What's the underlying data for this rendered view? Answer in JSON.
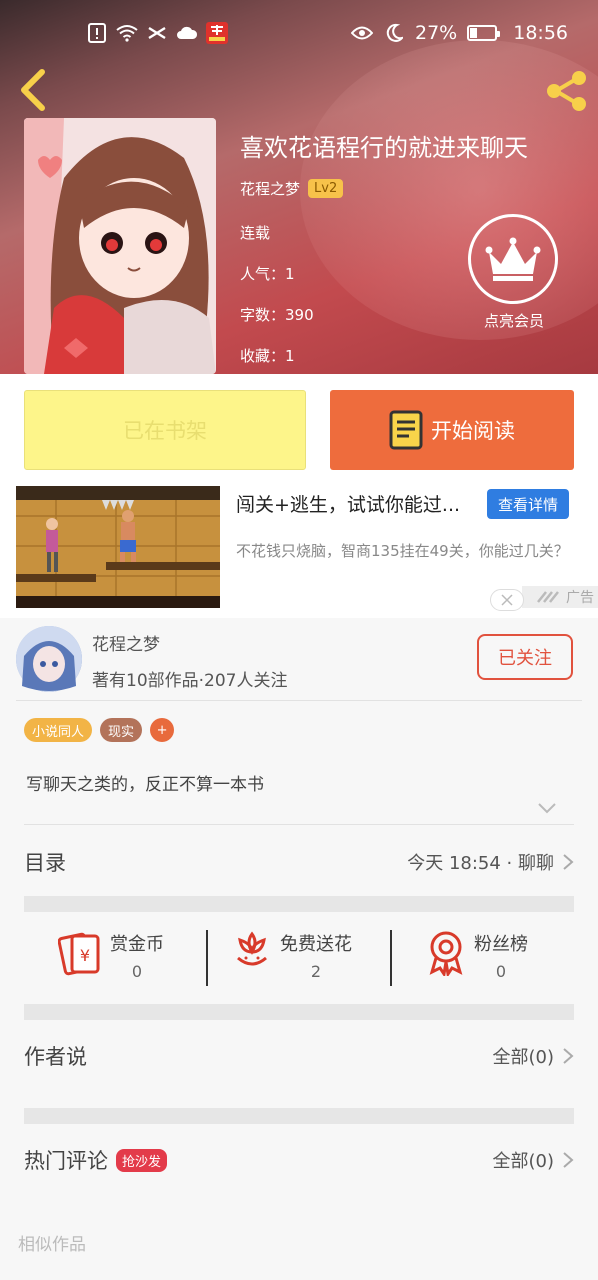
{
  "status_bar": {
    "battery": "27%",
    "time": "18:56"
  },
  "book": {
    "title": "喜欢花语程行的就进来聊天",
    "author": "花程之梦",
    "level": "Lv2",
    "state": "连载",
    "popularity": "人气：1",
    "words": "字数：390",
    "favorites": "收藏：1",
    "vip_label": "点亮会员"
  },
  "actions": {
    "shelf_label": "已在书架",
    "read_label": "开始阅读"
  },
  "ad": {
    "title": "闯关+逃生，试试你能过...",
    "detail_label": "查看详情",
    "description": "不花钱只烧脑，智商135挂在49关，你能过几关？",
    "tag": "广告"
  },
  "author_info": {
    "name": "花程之梦",
    "stats": "著有10部作品·207人关注",
    "follow_label": "已关注"
  },
  "tags": [
    "小说同人",
    "现实",
    "+"
  ],
  "summary": "写聊天之类的，反正不算一本书",
  "catalog": {
    "title": "目录",
    "latest": "今天 18:54 · 聊聊"
  },
  "rewards": [
    {
      "label": "赏金币",
      "value": "0",
      "icon": "red-envelope-icon"
    },
    {
      "label": "免费送花",
      "value": "2",
      "icon": "flower-icon"
    },
    {
      "label": "粉丝榜",
      "value": "0",
      "icon": "medal-icon"
    }
  ],
  "author_says": {
    "title": "作者说",
    "all": "全部(0)"
  },
  "hot_comments": {
    "title": "热门评论",
    "badge": "抢沙发",
    "all": "全部(0)"
  },
  "similar": "相似作品",
  "colors": {
    "accent": "#ee6c3d",
    "follow": "#e1523e",
    "shelf": "#fdf58a",
    "badge": "#e33b4a"
  }
}
